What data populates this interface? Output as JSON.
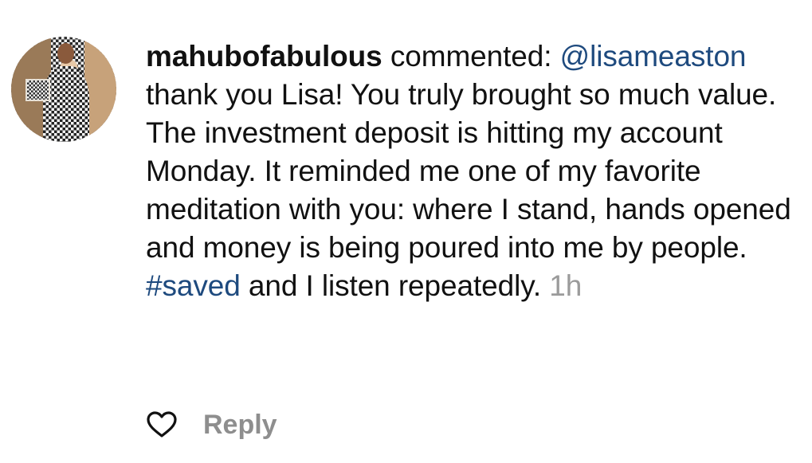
{
  "comment": {
    "username": "mahubofabulous",
    "action_text": "commented:",
    "mention": "@lisameaston",
    "body_part1": "thank you Lisa! You truly brought so much value. The investment deposit is hitting my account Monday. It reminded me one of my favorite meditation with you: where I stand, hands opened and money is being poured into me by people.",
    "hashtag": "#saved",
    "body_part2": "and I listen repeatedly.",
    "timestamp": "1h"
  },
  "actions": {
    "like_icon": "heart-outline-icon",
    "reply_label": "Reply"
  },
  "colors": {
    "link": "#1e4a7e",
    "muted": "#9b9b9b",
    "reply": "#8e8e8e"
  }
}
